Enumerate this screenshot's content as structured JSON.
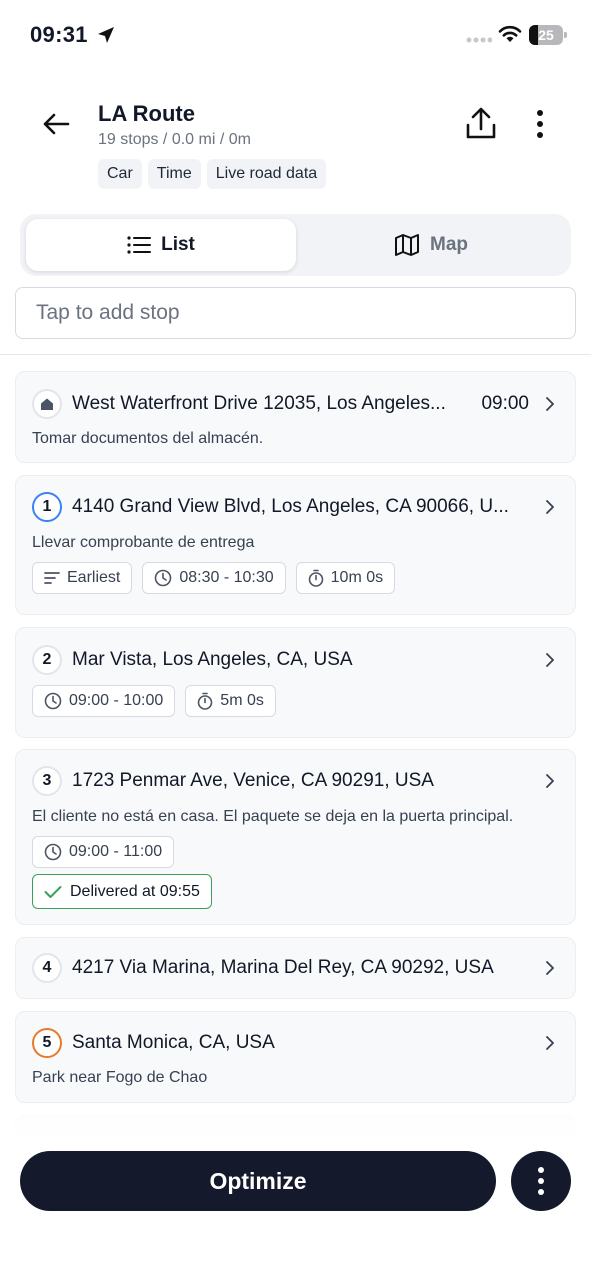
{
  "status_bar": {
    "time": "09:31",
    "battery": "25",
    "battery_level": 0.25
  },
  "header": {
    "title": "LA Route",
    "subtitle": "19 stops / 0.0 mi / 0m",
    "tags": [
      "Car",
      "Time",
      "Live road data"
    ]
  },
  "view_toggle": {
    "list_label": "List",
    "map_label": "Map",
    "selected": "List"
  },
  "search": {
    "placeholder": "Tap to add stop",
    "value": ""
  },
  "stops": [
    {
      "badge": "home-icon",
      "address": "West Waterfront Drive 12035, Los Angeles...",
      "time": "09:00",
      "note": "Tomar documentos del almacén."
    },
    {
      "badge": "1",
      "address": "4140 Grand View Blvd, Los Angeles, CA 90066, U...",
      "note": "Llevar comprobante de entrega",
      "chips": {
        "priority": "Earliest",
        "window": "08:30 - 10:30",
        "duration": "10m 0s"
      }
    },
    {
      "badge": "2",
      "address": "Mar Vista, Los Angeles, CA, USA",
      "chips": {
        "window": "09:00 - 10:00",
        "duration": "5m 0s"
      }
    },
    {
      "badge": "3",
      "address": "1723 Penmar Ave, Venice, CA 90291, USA",
      "note": "El cliente no está en casa. El paquete se deja en la puerta principal.",
      "chips": {
        "window": "09:00 - 11:00"
      },
      "status": "Delivered at 09:55"
    },
    {
      "badge": "4",
      "address": "4217 Via Marina, Marina Del Rey, CA 90292, USA"
    },
    {
      "badge": "5",
      "address": "Santa Monica, CA, USA",
      "note": "Park near Fogo de Chao"
    }
  ],
  "actions": {
    "optimize_label": "Optimize"
  },
  "colors": {
    "primary": "#141a2c",
    "badge_blue": "#3b82f6",
    "badge_orange": "#ea7a2a",
    "delivered_green": "#3aa05a"
  }
}
